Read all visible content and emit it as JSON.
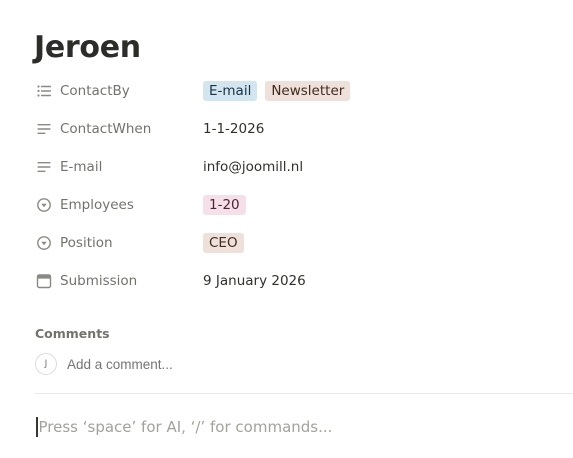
{
  "page": {
    "title": "Jeroen"
  },
  "properties": [
    {
      "icon": "list-icon",
      "name": "ContactBy",
      "type": "multi_select",
      "tags": [
        {
          "label": "E-mail",
          "color": "blue"
        },
        {
          "label": "Newsletter",
          "color": "brown"
        }
      ]
    },
    {
      "icon": "text-lines-icon",
      "name": "ContactWhen",
      "type": "text",
      "value": "1-1-2026"
    },
    {
      "icon": "text-lines-icon",
      "name": "E-mail",
      "type": "text",
      "value": "info@joomill.nl"
    },
    {
      "icon": "select-icon",
      "name": "Employees",
      "type": "select",
      "tags": [
        {
          "label": "1-20",
          "color": "pink"
        }
      ]
    },
    {
      "icon": "select-icon",
      "name": "Position",
      "type": "select",
      "tags": [
        {
          "label": "CEO",
          "color": "brown"
        }
      ]
    },
    {
      "icon": "calendar-icon",
      "name": "Submission",
      "type": "date",
      "value": "9 January 2026"
    }
  ],
  "comments": {
    "label": "Comments",
    "avatar_initial": "J",
    "placeholder": "Add a comment..."
  },
  "editor": {
    "placeholder": "Press ‘space’ for AI, ‘/’ for commands..."
  },
  "colors": {
    "tag_blue_bg": "#d3e5ef",
    "tag_brown_bg": "#eee0da",
    "tag_pink_bg": "#f5e0e9",
    "muted_text": "#73726e"
  }
}
